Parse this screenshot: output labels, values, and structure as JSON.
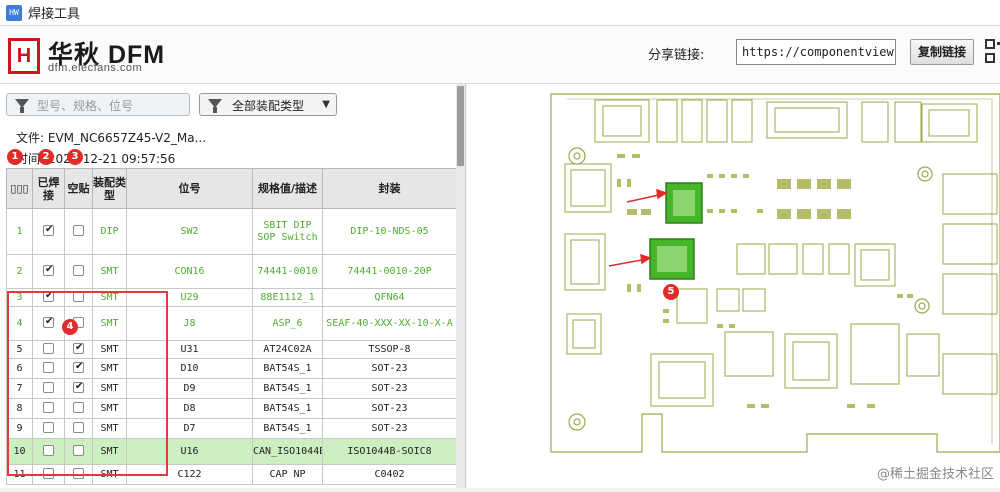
{
  "window": {
    "title": "焊接工具",
    "app_icon": "app-icon"
  },
  "header": {
    "logo_mark": "H",
    "logo_main": "华秋 DFM",
    "logo_sub": "dfm.elecfans.com",
    "share_label": "分享链接:",
    "share_url": "https://componentview",
    "copy_button": "复制链接"
  },
  "toolbar": {
    "search_placeholder": "型号、规格、位号",
    "type_filter_value": "全部装配类型"
  },
  "info": {
    "file_line": "文件: EVM_NC6657Z45-V2_Ma...",
    "time_line": "时间: 2023-12-21 09:57:56"
  },
  "badges": [
    "1",
    "2",
    "3",
    "4",
    "5"
  ],
  "table": {
    "headers": [
      "▯▯▯",
      "已焊接",
      "空贴",
      "装配类型",
      "位号",
      "规格值/描述",
      "封装"
    ],
    "rows": [
      {
        "idx": "1",
        "soldered": true,
        "empty": false,
        "type": "DIP",
        "ref": "SW2",
        "spec": "SBIT DIP SOP Switch",
        "pkg": "DIP-10-NDS-05",
        "green": true,
        "selected": false
      },
      {
        "idx": "2",
        "soldered": true,
        "empty": false,
        "type": "SMT",
        "ref": "CON16",
        "spec": "74441-0010",
        "pkg": "74441-0010-20P",
        "green": true,
        "selected": false
      },
      {
        "idx": "3",
        "soldered": true,
        "empty": false,
        "type": "SMT",
        "ref": "U29",
        "spec": "88E1112_1",
        "pkg": "QFN64",
        "green": true,
        "selected": false
      },
      {
        "idx": "4",
        "soldered": true,
        "empty": false,
        "type": "SMT",
        "ref": "J8",
        "spec": "ASP_6",
        "pkg": "SEAF-40-XXX-XX-10-X-A",
        "green": true,
        "selected": false
      },
      {
        "idx": "5",
        "soldered": false,
        "empty": true,
        "type": "SMT",
        "ref": "U31",
        "spec": "AT24C02A",
        "pkg": "TSSOP-8",
        "green": false,
        "selected": false
      },
      {
        "idx": "6",
        "soldered": false,
        "empty": true,
        "type": "SMT",
        "ref": "D10",
        "spec": "BAT54S_1",
        "pkg": "SOT-23",
        "green": false,
        "selected": false
      },
      {
        "idx": "7",
        "soldered": false,
        "empty": true,
        "type": "SMT",
        "ref": "D9",
        "spec": "BAT54S_1",
        "pkg": "SOT-23",
        "green": false,
        "selected": false
      },
      {
        "idx": "8",
        "soldered": false,
        "empty": false,
        "type": "SMT",
        "ref": "D8",
        "spec": "BAT54S_1",
        "pkg": "SOT-23",
        "green": false,
        "selected": false
      },
      {
        "idx": "9",
        "soldered": false,
        "empty": false,
        "type": "SMT",
        "ref": "D7",
        "spec": "BAT54S_1",
        "pkg": "SOT-23",
        "green": false,
        "selected": false
      },
      {
        "idx": "10",
        "soldered": false,
        "empty": false,
        "type": "SMT",
        "ref": "U16",
        "spec": "CAN_ISO1044B",
        "pkg": "ISO1044B-SOIC8",
        "green": false,
        "selected": true
      },
      {
        "idx": "11",
        "soldered": false,
        "empty": false,
        "type": "SMT",
        "ref": "C122",
        "spec": "CAP NP",
        "pkg": "C0402",
        "green": false,
        "selected": false
      }
    ]
  },
  "colors": {
    "pcb_silk": "#9aa84a",
    "pcb_highlight": "#45b52a",
    "accent_red": "#e02b2b",
    "brand_red": "#c8161d"
  },
  "watermark": "@稀土掘金技术社区"
}
